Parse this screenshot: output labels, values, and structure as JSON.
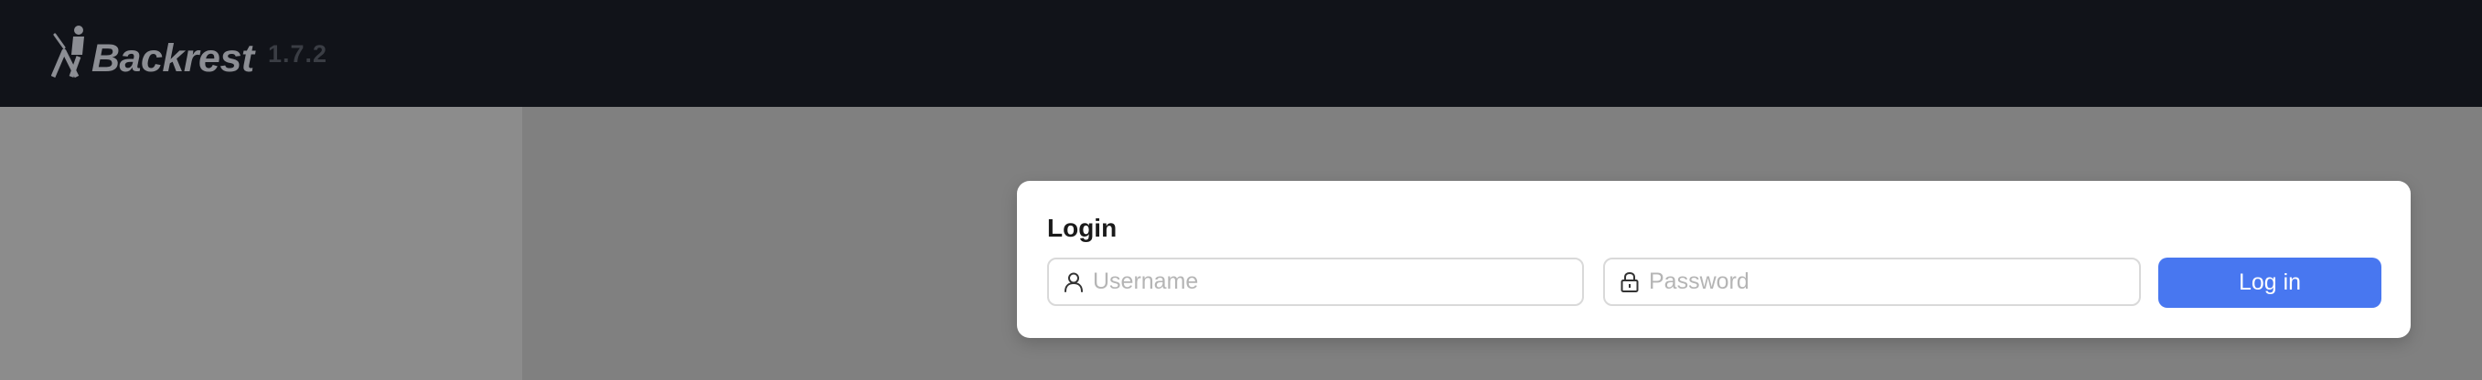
{
  "app": {
    "name": "Backrest",
    "version": "1.7.2"
  },
  "login": {
    "title": "Login",
    "username_placeholder": "Username",
    "username_value": "",
    "password_placeholder": "Password",
    "password_value": "",
    "submit_label": "Log in"
  },
  "icons": {
    "logo": "backrest-logo-icon",
    "username": "user-icon",
    "password": "lock-icon"
  },
  "colors": {
    "header_bg": "#111319",
    "overlay_bg": "#808080",
    "primary": "#4877f0"
  }
}
